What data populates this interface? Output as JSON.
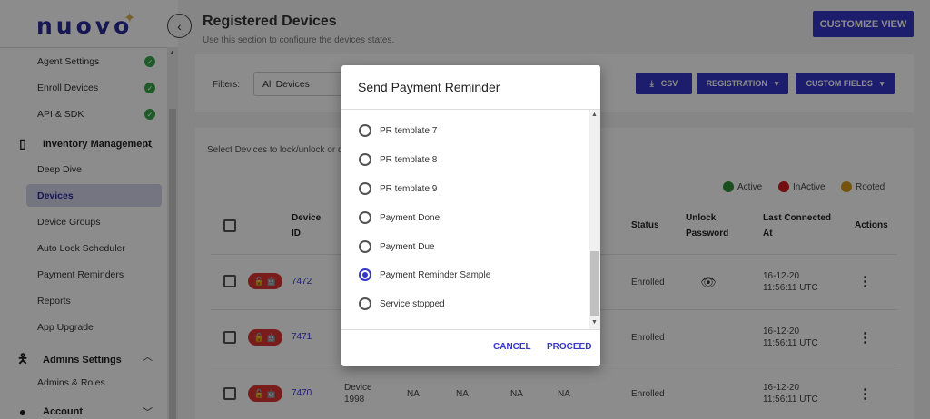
{
  "sidebar": {
    "logo": "nuovo",
    "items_top": [
      {
        "label": "Agent Settings"
      },
      {
        "label": "Enroll Devices"
      },
      {
        "label": "API & SDK"
      }
    ],
    "section_inventory": "Inventory Management",
    "inventory_items": [
      {
        "label": "Deep Dive"
      },
      {
        "label": "Devices"
      },
      {
        "label": "Device Groups"
      },
      {
        "label": "Auto Lock Scheduler"
      },
      {
        "label": "Payment Reminders"
      },
      {
        "label": "Reports"
      },
      {
        "label": "App Upgrade"
      }
    ],
    "section_admins": "Admins Settings",
    "admin_items": [
      {
        "label": "Admins & Roles"
      }
    ],
    "section_account": "Account",
    "active_item": "Devices"
  },
  "header": {
    "title": "Registered Devices",
    "subtitle": "Use this section to configure the devices states.",
    "customize_label": "CUSTOMIZE VIEW"
  },
  "filters": {
    "label": "Filters:",
    "selected": "All Devices",
    "csv_label": "CSV",
    "registration_label": "REGISTRATION",
    "custom_fields_label": "CUSTOM FIELDS"
  },
  "table": {
    "hint": "Select Devices to lock/unlock or d",
    "legend": [
      {
        "label": "Active",
        "color": "#2f8f3a"
      },
      {
        "label": "InActive",
        "color": "#d11a1a"
      },
      {
        "label": "Rooted",
        "color": "#d99a1a"
      }
    ],
    "headers": {
      "device_id": "Device ID",
      "status": "Status",
      "unlock_password": "Unlock Password",
      "last_connected": "Last Connected At",
      "actions": "Actions"
    },
    "rows": [
      {
        "id": "7472",
        "status": "Enrolled",
        "date": "16-12-20",
        "time": "11:56:11 UTC",
        "name": "",
        "na": []
      },
      {
        "id": "7471",
        "status": "Enrolled",
        "date": "16-12-20",
        "time": "11:56:11 UTC",
        "name": "",
        "na": []
      },
      {
        "id": "7470",
        "status": "Enrolled",
        "date": "16-12-20",
        "time": "11:56:11 UTC",
        "name": "Device 1998",
        "na": [
          "NA",
          "NA",
          "NA",
          "NA"
        ]
      }
    ]
  },
  "dialog": {
    "title": "Send Payment Reminder",
    "options": [
      {
        "label": "PR template 7",
        "selected": false
      },
      {
        "label": "PR template 8",
        "selected": false
      },
      {
        "label": "PR template 9",
        "selected": false
      },
      {
        "label": "Payment Done",
        "selected": false
      },
      {
        "label": "Payment Due",
        "selected": false
      },
      {
        "label": "Payment Reminder Sample",
        "selected": true
      },
      {
        "label": "Service stopped",
        "selected": false
      }
    ],
    "cancel_label": "CANCEL",
    "proceed_label": "PROCEED"
  }
}
